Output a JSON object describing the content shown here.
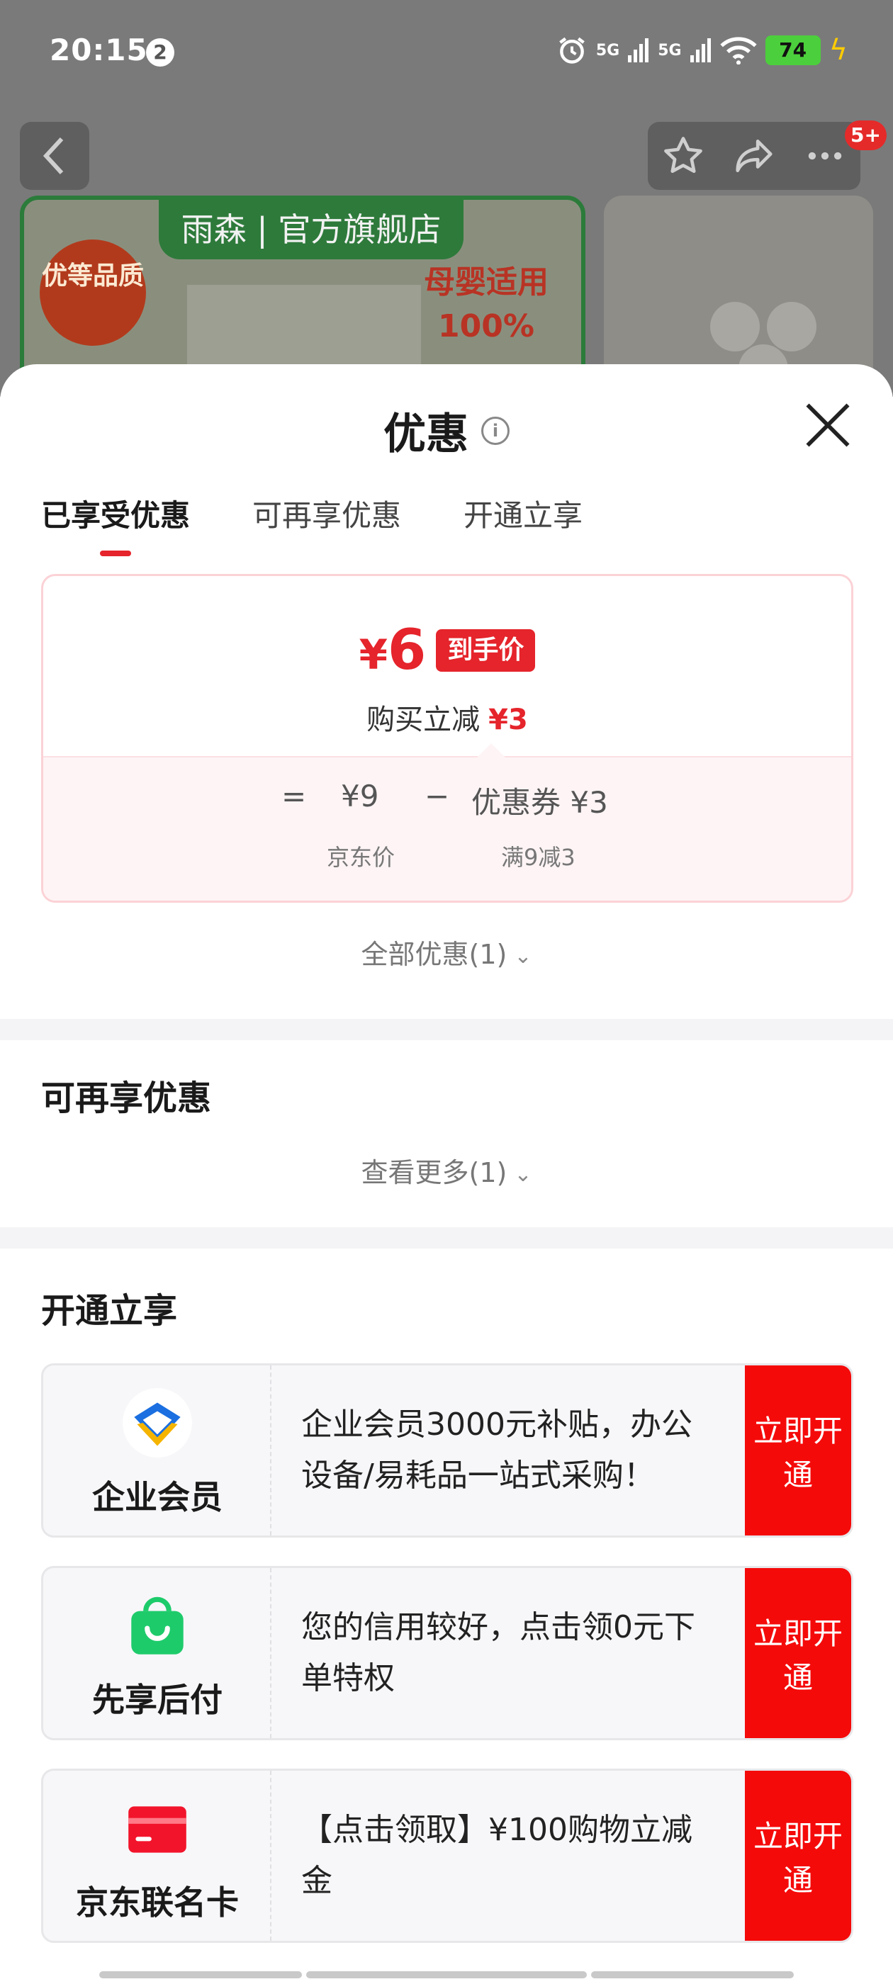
{
  "status_bar": {
    "time": "20:15",
    "notification_count": "2",
    "signal_1": "5G",
    "signal_2": "5G",
    "battery": "74"
  },
  "background": {
    "store_banner": "雨森 | 官方旗舰店",
    "stamp_text": "优等品质",
    "slogan": "母婴适用 100%",
    "cart_badge": "5+"
  },
  "sheet": {
    "title": "优惠",
    "tabs": [
      {
        "label": "已享受优惠",
        "active": true
      },
      {
        "label": "可再享优惠",
        "active": false
      },
      {
        "label": "开通立享",
        "active": false
      }
    ]
  },
  "price_card": {
    "final_price_symbol": "¥",
    "final_price": "6",
    "final_tag": "到手价",
    "saving_label": "购买立减",
    "saving_amount": "¥3",
    "eq": "=",
    "base_price": "¥9",
    "minus": "−",
    "coupon": "优惠券 ¥3",
    "base_label": "京东价",
    "coupon_label": "满9减3"
  },
  "all_offers": "全部优惠(1)",
  "more_offers_section": {
    "title": "可再享优惠",
    "link": "查看更多(1)"
  },
  "open_section": {
    "title": "开通立享",
    "items": [
      {
        "name": "企业会员",
        "desc": "企业会员3000元补贴，办公设备/易耗品一站式采购！",
        "button": "立即开通",
        "icon": "enterprise-member-icon"
      },
      {
        "name": "先享后付",
        "desc": "您的信用较好，点击领0元下单特权",
        "button": "立即开通",
        "icon": "shopping-bag-icon"
      },
      {
        "name": "京东联名卡",
        "desc": "【点击领取】¥100购物立减金",
        "button": "立即开通",
        "icon": "credit-card-icon"
      }
    ]
  },
  "colors": {
    "accent_red": "#e5242b",
    "button_red": "#f50a0a",
    "green_icon": "#1ecb6b"
  }
}
